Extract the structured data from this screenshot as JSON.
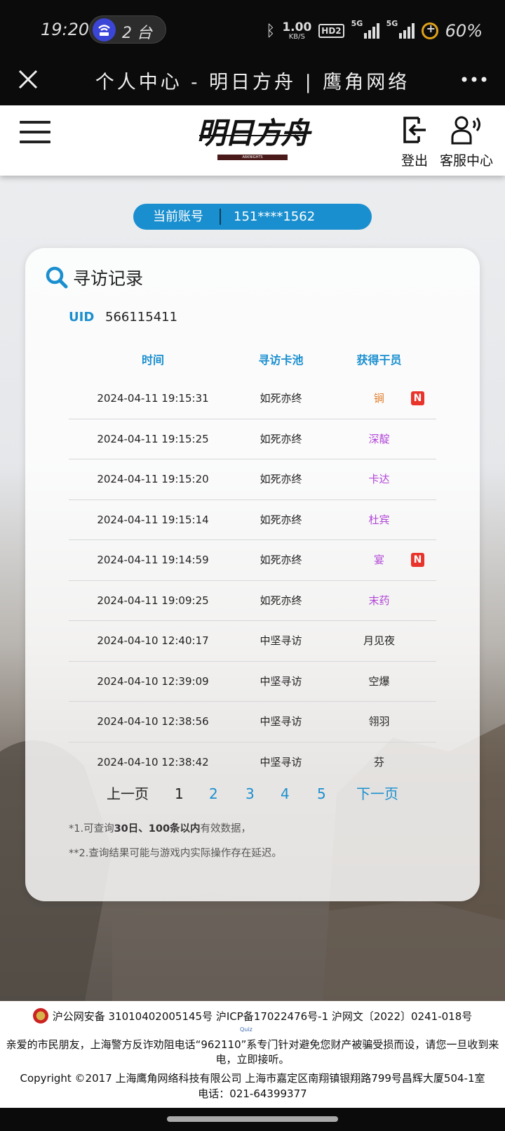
{
  "status_bar": {
    "time": "19:20",
    "pill_count": "2 台",
    "speed_value": "1.00",
    "speed_unit": "KB/S",
    "hd_label": "HD2",
    "signal1_tag": "5G",
    "signal2_tag": "5G",
    "battery": "60%"
  },
  "browser": {
    "title": "个人中心 - 明日方舟 | 鹰角网络",
    "close_icon": "close-icon",
    "more_icon": "more-dots-icon"
  },
  "navbar": {
    "logo_text": "明日方舟",
    "logo_subtext": "ARKNIGHTS",
    "logout_label": "登出",
    "service_label": "客服中心"
  },
  "account": {
    "label": "当前账号",
    "value": "151****1562"
  },
  "card": {
    "title": "寻访记录",
    "uid_label": "UID",
    "uid_value": "566115411",
    "columns": [
      "时间",
      "寻访卡池",
      "获得干员"
    ],
    "rows": [
      {
        "time": "2024-04-11 19:15:31",
        "pool": "如死亦终",
        "operator": "锏",
        "color": "#e07b26",
        "new": "N"
      },
      {
        "time": "2024-04-11 19:15:25",
        "pool": "如死亦终",
        "operator": "深靛",
        "color": "#b146d6",
        "new": ""
      },
      {
        "time": "2024-04-11 19:15:20",
        "pool": "如死亦终",
        "operator": "卡达",
        "color": "#b146d6",
        "new": ""
      },
      {
        "time": "2024-04-11 19:15:14",
        "pool": "如死亦终",
        "operator": "杜宾",
        "color": "#b146d6",
        "new": ""
      },
      {
        "time": "2024-04-11 19:14:59",
        "pool": "如死亦终",
        "operator": "宴",
        "color": "#b146d6",
        "new": "N"
      },
      {
        "time": "2024-04-11 19:09:25",
        "pool": "如死亦终",
        "operator": "末药",
        "color": "#b146d6",
        "new": ""
      },
      {
        "time": "2024-04-10 12:40:17",
        "pool": "中坚寻访",
        "operator": "月见夜",
        "color": "#222222",
        "new": ""
      },
      {
        "time": "2024-04-10 12:39:09",
        "pool": "中坚寻访",
        "operator": "空爆",
        "color": "#222222",
        "new": ""
      },
      {
        "time": "2024-04-10 12:38:56",
        "pool": "中坚寻访",
        "operator": "翎羽",
        "color": "#222222",
        "new": ""
      },
      {
        "time": "2024-04-10 12:38:42",
        "pool": "中坚寻访",
        "operator": "芬",
        "color": "#222222",
        "new": ""
      }
    ],
    "pager": {
      "prev": "上一页",
      "pages": [
        "1",
        "2",
        "3",
        "4",
        "5"
      ],
      "current": "1",
      "next": "下一页"
    },
    "note1_prefix": "*1.可查询",
    "note1_bold": "30日、100条以内",
    "note1_suffix": "有效数据，",
    "note2": "**2.查询结果可能与游戏内实际操作存在延迟。"
  },
  "footer": {
    "line1": "沪公网安备 31010402005145号  沪ICP备17022476号-1  沪网文〔2022〕0241-018号",
    "mini_badge": "Quiz",
    "line2": "亲爱的市民朋友，上海警方反诈劝阻电话“962110”系专门针对避免您财产被骗受损而设，请您一旦收到来电，立即接听。",
    "line3": "Copyright ©2017 上海鹰角网络科技有限公司  上海市嘉定区南翔镇银翔路799号昌辉大厦504-1室",
    "line4": "电话：021-64399377"
  },
  "colors": {
    "accent": "#1a8fcf",
    "six_star": "#e07b26",
    "five_star": "#b146d6",
    "new_badge": "#e8342a"
  }
}
